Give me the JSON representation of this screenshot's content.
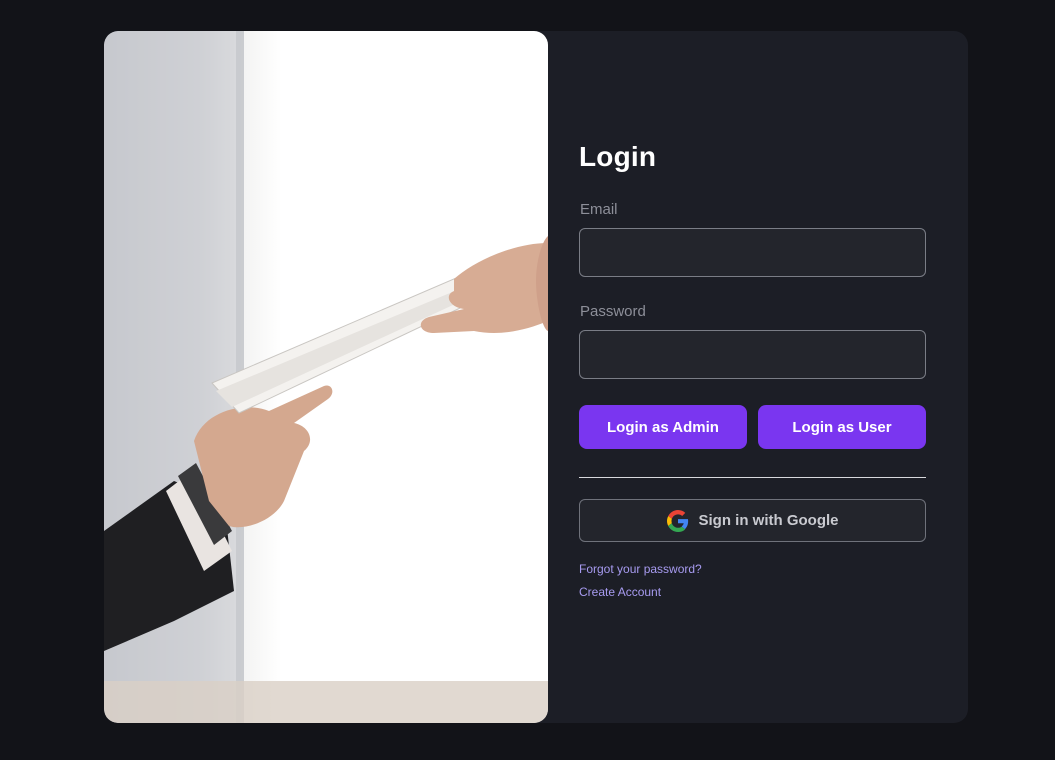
{
  "login": {
    "title": "Login",
    "email_label": "Email",
    "email_value": "",
    "password_label": "Password",
    "password_value": "",
    "admin_button": "Login as Admin",
    "user_button": "Login as User",
    "google_button": "Sign in with Google",
    "forgot_link": "Forgot your password?",
    "create_link": "Create Account"
  },
  "icons": {
    "google": "google-logo-icon"
  },
  "colors": {
    "page_bg": "#121318",
    "card_bg": "#1c1e26",
    "accent": "#7a36f0",
    "link": "#a79bf0"
  }
}
